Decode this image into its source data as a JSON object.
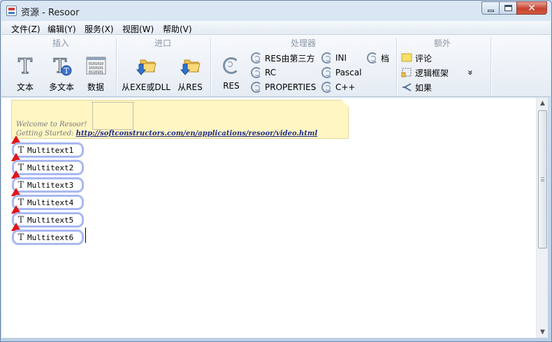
{
  "window": {
    "title": "资源 - Resoor"
  },
  "menu": [
    "文件(Z)",
    "编辑(Y)",
    "服务(X)",
    "视图(W)",
    "帮助(V)"
  ],
  "ribbon": {
    "groups": {
      "insert": "插入",
      "import": "进口",
      "handlers": "处理器",
      "extra": "额外"
    },
    "insert_buttons": {
      "text": "文本",
      "multitext": "多文本",
      "data": "数据"
    },
    "import_buttons": {
      "from_exe_dll": "从EXE或DLL",
      "from_res": "从RES"
    },
    "handler_buttons": {
      "res": "RES",
      "res_third_party": "RES由第三方",
      "rc": "RC",
      "properties": "PROPERTIES",
      "ini": "INI",
      "pascal": "Pascal",
      "cpp": "C++",
      "archive": "档"
    },
    "extra_buttons": {
      "comment": "评论",
      "logic_frame": "逻辑框架",
      "if": "如果",
      "more": "»"
    }
  },
  "document": {
    "note": {
      "welcome": "Welcome to Resoor!",
      "getting_started_label": "Getting Started:",
      "getting_started_link": "http://softconstructors.com/en/applications/resoor/video.html"
    },
    "items": [
      "Multitext1",
      "Multitext2",
      "Multitext3",
      "Multitext4",
      "Multitext5",
      "Multitext6"
    ]
  },
  "colors": {
    "warning": "#e0151a",
    "pill_border": "#a9b8f0",
    "note_bg": "#fff6c4",
    "link": "#1d2a8a"
  }
}
